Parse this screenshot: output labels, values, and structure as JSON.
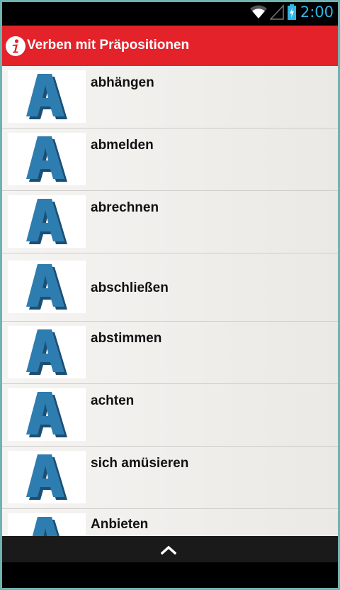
{
  "status_bar": {
    "time": "2:00",
    "icons": [
      "wifi-icon",
      "signal-icon",
      "battery-charging-icon"
    ]
  },
  "header": {
    "title": "Verben mit Präpositionen",
    "icon": "info-icon",
    "color": "#e3222a"
  },
  "list": {
    "items": [
      {
        "label": "abhängen"
      },
      {
        "label": "abmelden"
      },
      {
        "label": "abrechnen"
      },
      {
        "label": "abschließen"
      },
      {
        "label": "abstimmen"
      },
      {
        "label": "achten"
      },
      {
        "label": "sich amüsieren"
      },
      {
        "label": "Anbieten"
      }
    ],
    "thumbnail_icon": "letter-a-icon"
  },
  "bottom_bar": {
    "icon": "chevron-up-icon"
  },
  "colors": {
    "accent": "#33b5e5",
    "letter": "#2e7db0"
  }
}
